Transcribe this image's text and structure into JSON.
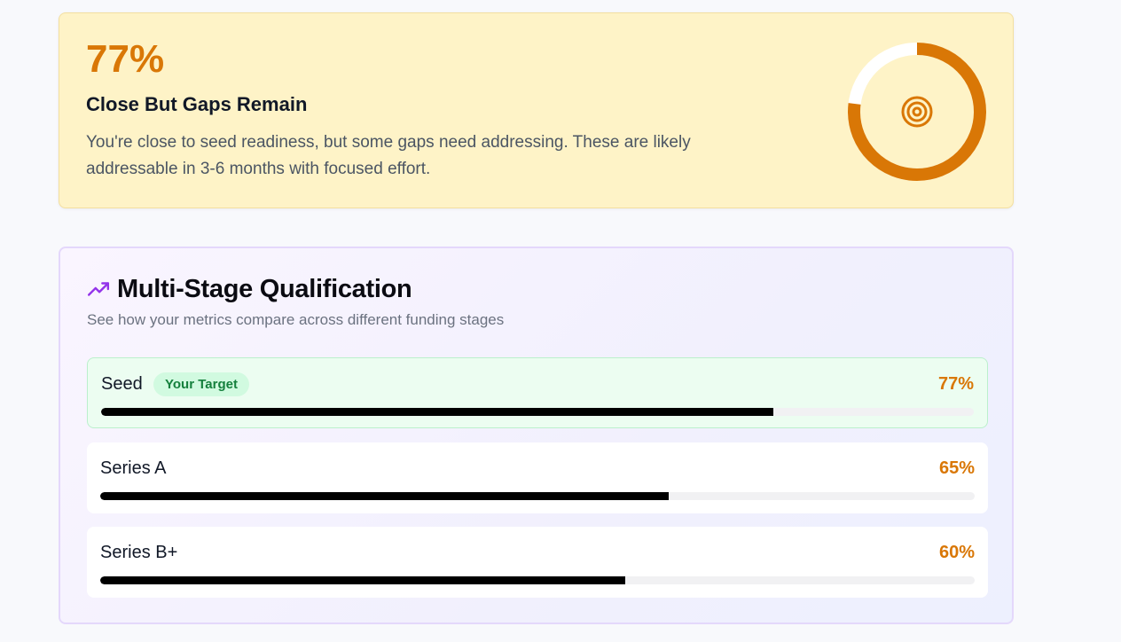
{
  "readiness": {
    "score": "77%",
    "score_value": 0.77,
    "verdict": "Close But Gaps Remain",
    "description": "You're close to seed readiness, but some gaps need addressing. These are likely addressable in 3-6 months with focused effort.",
    "icon": "target-icon",
    "accent_color": "#d97706",
    "background_color": "#fef3c7"
  },
  "stages": {
    "title": "Multi-Stage Qualification",
    "subtitle": "See how your metrics compare across different funding stages",
    "icon": "trending-up-icon",
    "items": [
      {
        "name": "Seed",
        "badge": "Your Target",
        "percent_label": "77%",
        "value": 0.77,
        "is_target": true
      },
      {
        "name": "Series A",
        "percent_label": "65%",
        "value": 0.65,
        "is_target": false
      },
      {
        "name": "Series B+",
        "percent_label": "60%",
        "value": 0.6,
        "is_target": false
      }
    ],
    "pct_color": "#d97706",
    "target_highlight_color": "#ecfdf1"
  }
}
